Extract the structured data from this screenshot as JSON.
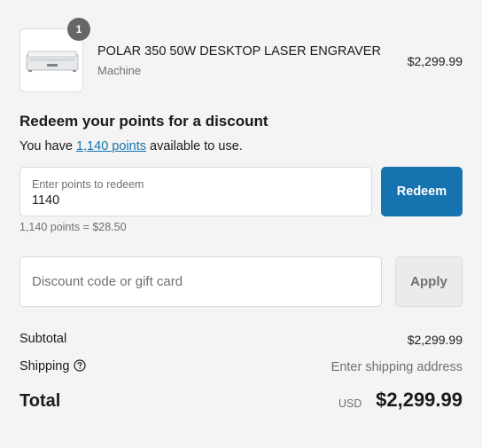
{
  "product": {
    "title": "POLAR 350 50W DESKTOP LASER ENGRAVER",
    "variant": "Machine",
    "price": "$2,299.99",
    "quantity": "1",
    "image_icon": "laser-engraver-icon"
  },
  "redeem": {
    "heading": "Redeem your points for a discount",
    "text_before": "You have ",
    "points_link": "1,140 points",
    "text_after": " available to use.",
    "field_label": "Enter points to redeem",
    "field_value": "1140",
    "button_label": "Redeem",
    "conversion_note": "1,140 points = $28.50"
  },
  "discount": {
    "placeholder": "Discount code or gift card",
    "button_label": "Apply"
  },
  "summary": {
    "subtotal_label": "Subtotal",
    "subtotal_value": "$2,299.99",
    "shipping_label": "Shipping",
    "shipping_value": "Enter shipping address",
    "help_icon": "question-circle-icon",
    "total_label": "Total",
    "currency": "USD",
    "total_value": "$2,299.99"
  },
  "colors": {
    "accent": "#1773b0",
    "background": "#f4f4f4",
    "muted_text": "#707070"
  }
}
